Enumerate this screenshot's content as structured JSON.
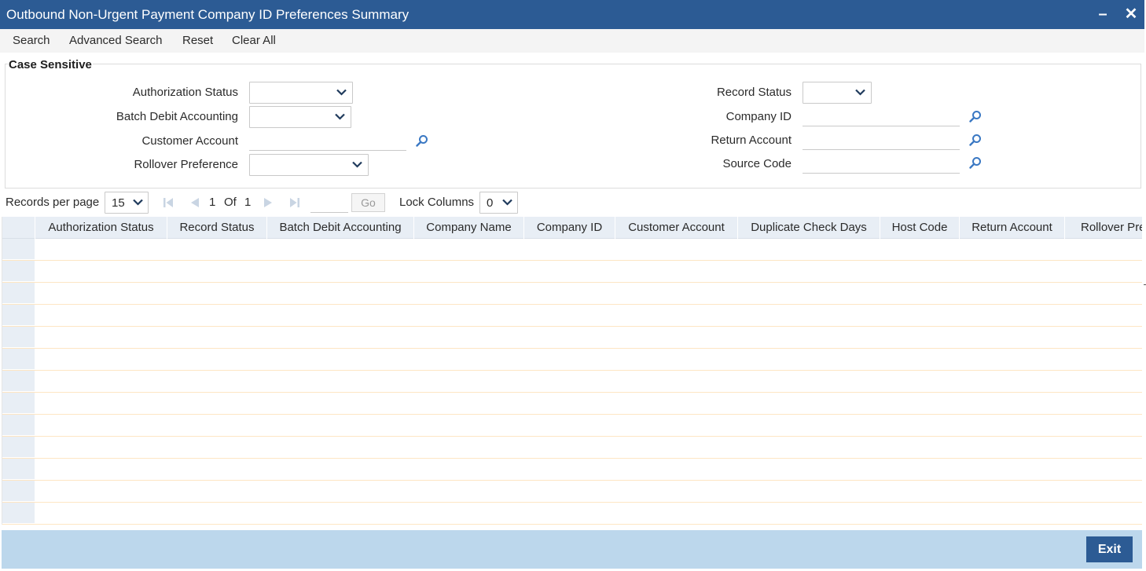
{
  "window": {
    "title": "Outbound Non-Urgent Payment Company ID Preferences Summary",
    "minimize_glyph": "–",
    "close_glyph": "✕"
  },
  "menu": [
    "Search",
    "Advanced Search",
    "Reset",
    "Clear All"
  ],
  "criteria": {
    "legend": "Case Sensitive",
    "authorization_status": {
      "label": "Authorization Status",
      "value": ""
    },
    "batch_debit_accounting": {
      "label": "Batch Debit Accounting",
      "value": ""
    },
    "customer_account": {
      "label": "Customer Account",
      "value": ""
    },
    "rollover_preference": {
      "label": "Rollover Preference",
      "value": ""
    },
    "record_status": {
      "label": "Record Status",
      "value": ""
    },
    "company_id": {
      "label": "Company ID",
      "value": ""
    },
    "return_account": {
      "label": "Return Account",
      "value": ""
    },
    "source_code": {
      "label": "Source Code",
      "value": ""
    }
  },
  "pager": {
    "records_label": "Records per page",
    "records_value": "15",
    "current_page": "1",
    "of_label": "Of",
    "total_pages": "1",
    "goto_value": "",
    "go_label": "Go",
    "lock_label": "Lock Columns",
    "lock_value": "0"
  },
  "grid": {
    "columns": [
      "Authorization Status",
      "Record Status",
      "Batch Debit Accounting",
      "Company Name",
      "Company ID",
      "Customer Account",
      "Duplicate Check Days",
      "Host Code",
      "Return Account",
      "Rollover Preference"
    ],
    "row_count": 13
  },
  "footer": {
    "exit_label": "Exit"
  },
  "colors": {
    "title_bar": "#2c5b94",
    "footer": "#bcd7ec",
    "grid_header": "#e8eef5",
    "row_line": "#fde6c4",
    "icon": "#3a78c3"
  }
}
